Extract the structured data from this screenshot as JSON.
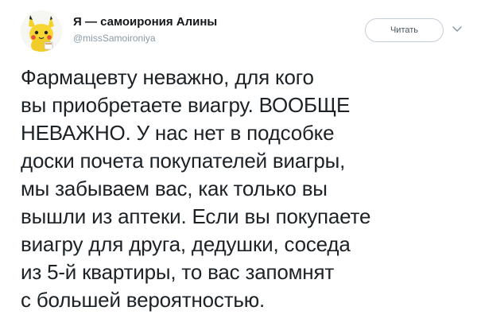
{
  "tweet": {
    "author_name": "Я — самоирония Алины",
    "author_handle": "@missSamoironiya",
    "follow_label": "Читать",
    "text_lines": [
      "Фармацевту неважно, для кого",
      "вы приобретаете виагру. ВООБЩЕ",
      "НЕВАЖНО. У нас нет в подсобке",
      "доски почета покупателей виагры,",
      "мы забываем вас, как только вы",
      "вышли из аптеки. Если вы покупаете",
      "виагру для друга, дедушки, соседа",
      "из 5-й квартиры, то вас запомнят",
      "с большей вероятностью."
    ]
  },
  "colors": {
    "handle": "#8899a6",
    "button_border": "#c5ced6",
    "text": "#1c2226"
  },
  "icons": {
    "avatar": "pikachu-avatar",
    "caret": "chevron-down-icon"
  }
}
